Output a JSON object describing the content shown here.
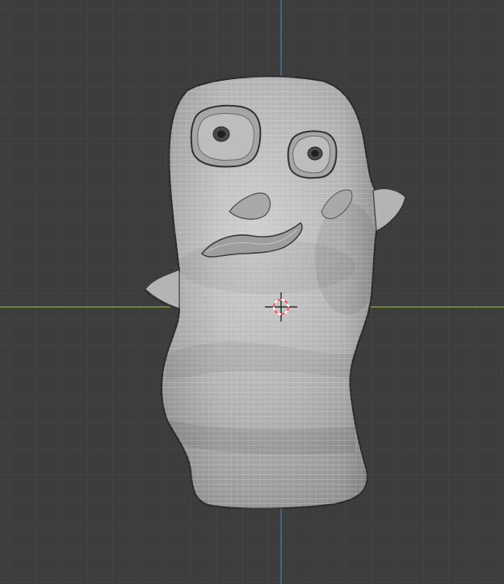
{
  "viewport": {
    "background_color": "#3d3d3d",
    "grid_line_color": "#4a4a4a",
    "x_axis_color": "#7a9c3b",
    "y_axis_color": "#4a6fa5"
  },
  "object": {
    "mesh_color": "#b5b5b5",
    "wire_color": "#e8e8e8",
    "shadow_color": "#8e8e8e",
    "outline_color": "#2a2a2a"
  },
  "cursor": {
    "ring_color_a": "#ff4a4a",
    "ring_color_b": "#ffffff",
    "cross_color": "#111111"
  },
  "icons": {
    "crosshair": "3d-cursor-icon"
  }
}
